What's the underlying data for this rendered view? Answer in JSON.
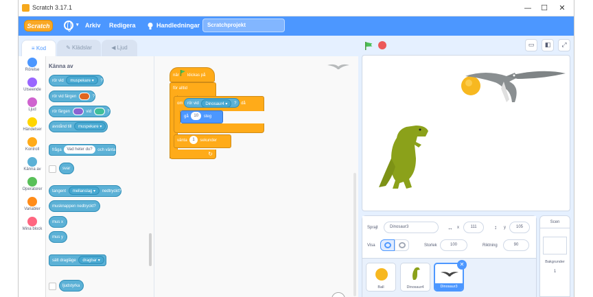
{
  "window": {
    "title": "Scratch 3.17.1",
    "controls": [
      "—",
      "☐",
      "✕"
    ]
  },
  "menubar": {
    "logo": "Scratch",
    "items": [
      "Arkiv",
      "Redigera"
    ],
    "tutorials": "Handledningar",
    "project_title": "Scratchprojekt"
  },
  "tabs": {
    "code": "Kod",
    "costumes": "Klädslar",
    "sounds": "Ljud"
  },
  "categories": [
    {
      "label": "Rörelse",
      "color": "#4c97ff"
    },
    {
      "label": "Utseende",
      "color": "#9966ff"
    },
    {
      "label": "Ljud",
      "color": "#cf63cf"
    },
    {
      "label": "Händelser",
      "color": "#ffd500"
    },
    {
      "label": "Kontroll",
      "color": "#ffab19"
    },
    {
      "label": "Känna av",
      "color": "#5cb1d6"
    },
    {
      "label": "Operatorer",
      "color": "#59c059"
    },
    {
      "label": "Variabler",
      "color": "#ff8c1a"
    },
    {
      "label": "Mina block",
      "color": "#ff6680"
    }
  ],
  "palette": {
    "heading": "Känna av",
    "touching": {
      "pre": "rör vid",
      "menu": "muspekare",
      "post": "?"
    },
    "touching_color": {
      "pre": "rör vid färgen",
      "post": "?",
      "color": "#e0661f"
    },
    "color_touching": {
      "pre": "rör färgen",
      "mid": "vid",
      "post": "?",
      "color1": "#8a63d2",
      "color2": "#3fbf9a"
    },
    "distance": {
      "pre": "avstånd till",
      "menu": "muspekare"
    },
    "ask": {
      "pre": "fråga",
      "input": "Vad heter du?",
      "post": "och vänta"
    },
    "answer": "svar",
    "key_pressed": {
      "pre": "tangent",
      "menu": "mellanslag",
      "post": "nedtryckt?"
    },
    "mouse_down": "musknappen nedtryckt?",
    "mouse_x": "mus x",
    "mouse_y": "mus y",
    "drag_mode": {
      "pre": "sätt dragläge",
      "menu": "dragbar"
    },
    "loudness": "ljudstyrka"
  },
  "script": {
    "hat": {
      "pre": "när",
      "post": "klickas på"
    },
    "forever": "för alltid",
    "if": {
      "pre": "om",
      "touch_pre": "rör vid",
      "touch_menu": "Dinosaur4",
      "touch_post": "?",
      "then": "då"
    },
    "move": {
      "pre": "gå",
      "value": "10",
      "post": "steg"
    },
    "wait": {
      "pre": "vänta",
      "value": "1",
      "post": "sekunder"
    }
  },
  "sprite_info": {
    "sprite_label": "Sprajt",
    "sprite_name": "Dinosaur3",
    "x_label": "x",
    "x": "111",
    "y_label": "y",
    "y": "105",
    "show_label": "Visa",
    "size_label": "Storlek",
    "size": "100",
    "direction_label": "Riktning",
    "direction": "90"
  },
  "sprites": [
    {
      "name": "Ball",
      "selected": false
    },
    {
      "name": "Dinosaur4",
      "selected": false
    },
    {
      "name": "Dinosaur3",
      "selected": true
    }
  ],
  "stage_panel": {
    "title": "Scen",
    "backdrops_label": "Bakgrunder",
    "backdrops_count": "1"
  }
}
